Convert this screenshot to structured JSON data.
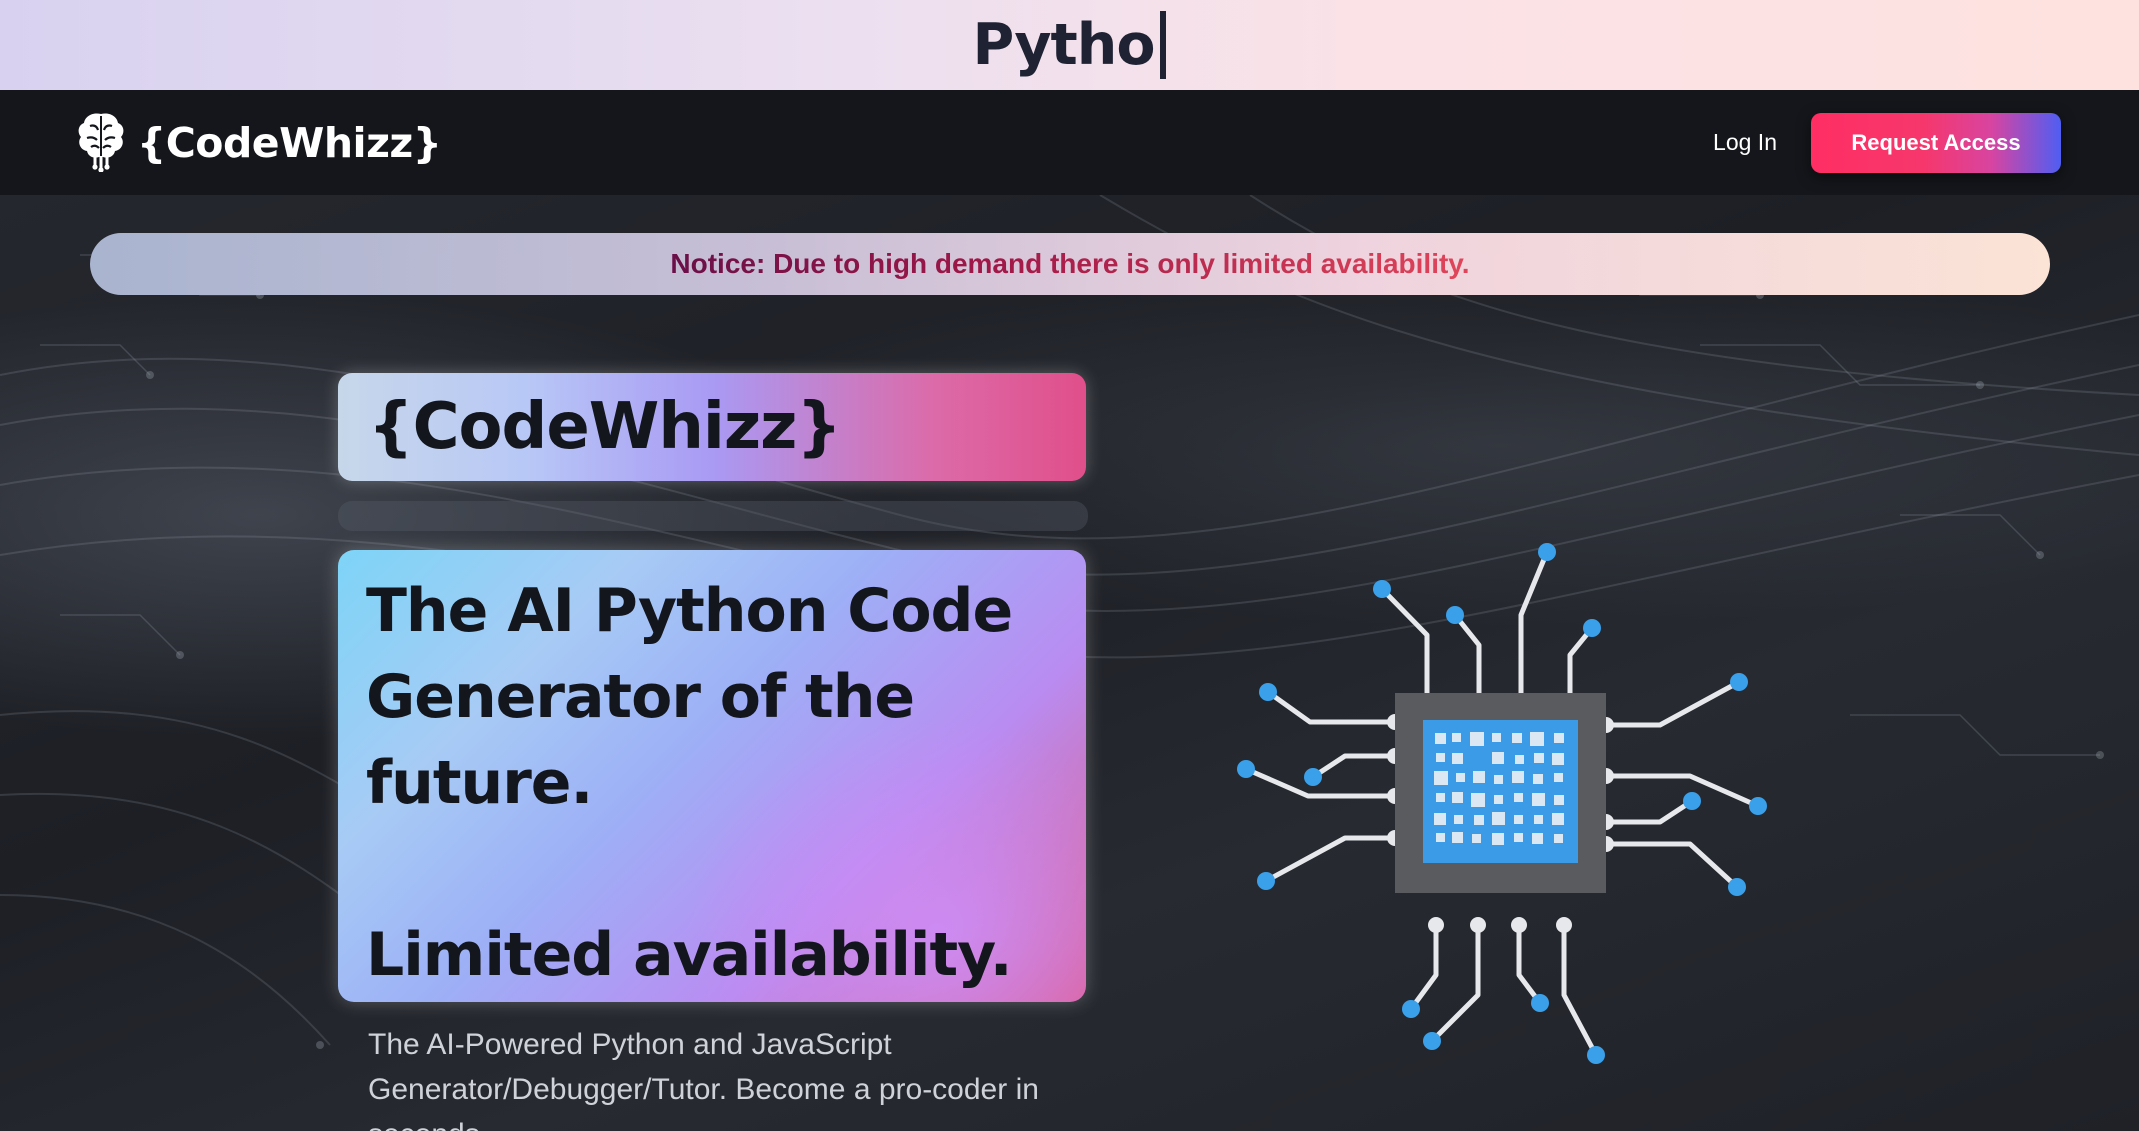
{
  "banner": {
    "typed_text": "Pytho"
  },
  "nav": {
    "brand": "{CodeWhizz}",
    "brand_icon": "brain-circuit-icon",
    "login_label": "Log In",
    "cta_label": "Request Access"
  },
  "notice": {
    "text": "Notice: Due to high demand there is only limited availability."
  },
  "hero": {
    "brand_card": "{CodeWhizz}",
    "headline_line1": "The AI Python Code",
    "headline_line2": "Generator of the",
    "headline_line3": "future.",
    "headline_line4": "Limited availability.",
    "description": "The AI-Powered Python and JavaScript Generator/Debugger/Tutor. Become a pro-coder in seconds.",
    "illustration_icon": "cpu-chip-icon"
  },
  "colors": {
    "nav_bg": "#14161b",
    "accent_pink": "#ff2e63",
    "accent_blue": "#4f5ef2",
    "chip_blue": "#3b9be6"
  }
}
